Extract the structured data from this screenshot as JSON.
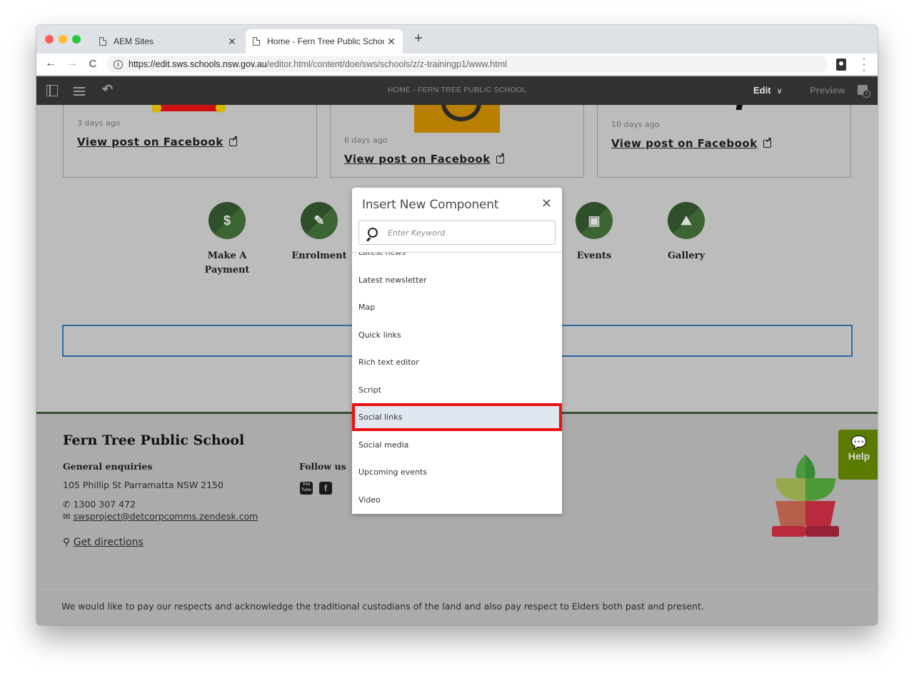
{
  "browser": {
    "tabs": [
      {
        "title": "AEM Sites",
        "active": false
      },
      {
        "title": "Home - Fern Tree Public Schoo",
        "active": true
      }
    ],
    "url": {
      "host": "https://edit.sws.schools.nsw.gov.au",
      "path": "/editor.html/content/doe/sws/schools/z/z-trainingp1/www.html"
    }
  },
  "aem_toolbar": {
    "page_title": "HOME - FERN TREE PUBLIC SCHOOL",
    "mode": "Edit",
    "preview_label": "Preview"
  },
  "facebook_cards": [
    {
      "time": "3 days ago",
      "link": "View post on Facebook"
    },
    {
      "time": "6 days ago",
      "link": "View post on Facebook"
    },
    {
      "time": "10 days ago",
      "link": "View post on Facebook"
    }
  ],
  "quick_links": [
    {
      "label": "Make A Payment",
      "icon": "dollar-icon",
      "glyph": "$"
    },
    {
      "label": "Enrolment",
      "icon": "pencil-icon",
      "glyph": "✎"
    },
    {
      "label": "Events",
      "icon": "calendar-icon",
      "glyph": "▣"
    },
    {
      "label": "Gallery",
      "icon": "photos-icon",
      "glyph": "⛰"
    }
  ],
  "footer": {
    "school_name": "Fern Tree Public School",
    "general_enquiries_heading": "General enquiries",
    "address": "105 Phillip St Parramatta NSW 2150",
    "phone": "1300 307 472",
    "email": "swsproject@detcorpcomms.zendesk.com",
    "directions": "Get directions",
    "follow_us_heading": "Follow us",
    "acknowledgement": "We would like to pay our respects and acknowledge the traditional custodians of the land and also pay respect to Elders both past and present."
  },
  "help": {
    "label": "Help"
  },
  "dialog": {
    "title": "Insert New Component",
    "search_placeholder": "Enter Keyword",
    "items": [
      "Latest news",
      "Latest newsletter",
      "Map",
      "Quick links",
      "Rich text editor",
      "Script",
      "Social links",
      "Social media",
      "Upcoming events",
      "Video"
    ],
    "selected": "Social links"
  }
}
